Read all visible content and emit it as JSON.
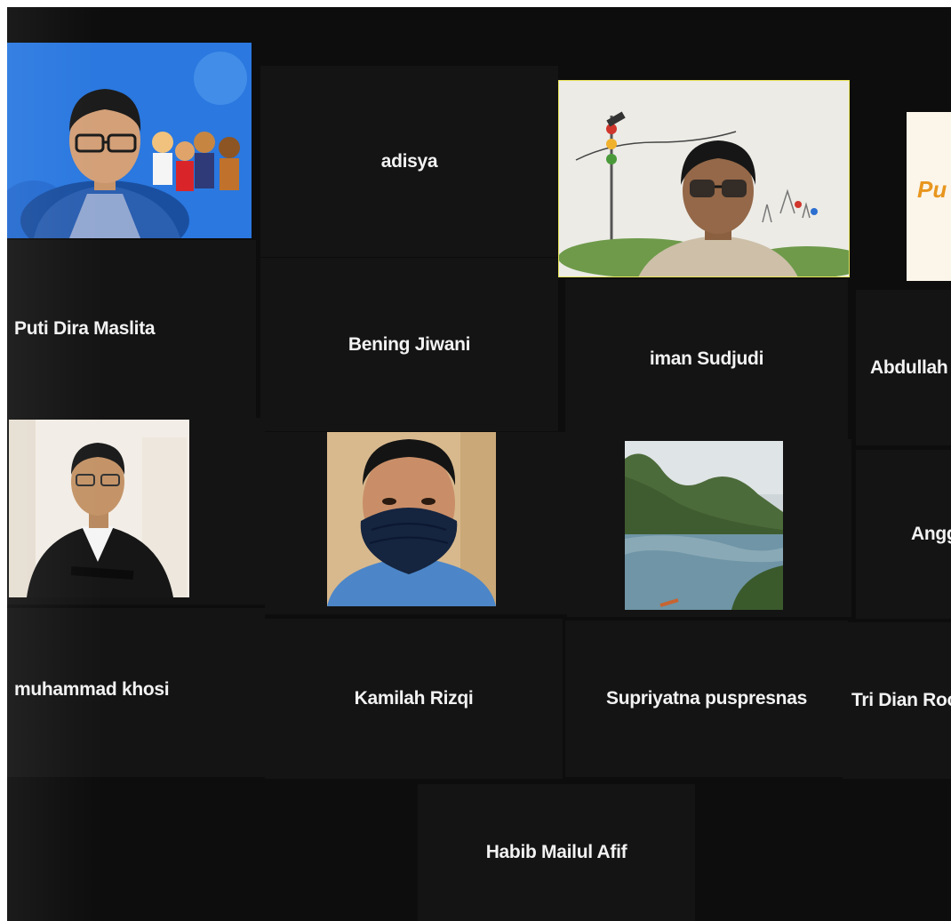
{
  "participants": [
    {
      "name": "Puti Dira Maslita"
    },
    {
      "name": "adisya"
    },
    {
      "name": "iman Sudjudi"
    },
    {
      "name": "Abdullah"
    },
    {
      "name": "Bening Jiwani"
    },
    {
      "name": "muhammad khosi"
    },
    {
      "name": "Kamilah Rizqi"
    },
    {
      "name": "Supriyatna puspresnas"
    },
    {
      "name": "Tri Dian Roc"
    },
    {
      "name": "Angg"
    },
    {
      "name": "Habib Mailul Afif"
    }
  ],
  "background_logo_text": "Pu",
  "colors": {
    "active_speaker_border": "#e9e65a",
    "tile_background": "#141414",
    "logo_orange": "#e8961e"
  },
  "icons": {
    "face_mask": "mask-icon",
    "landscape": "island-landscape-icon"
  }
}
